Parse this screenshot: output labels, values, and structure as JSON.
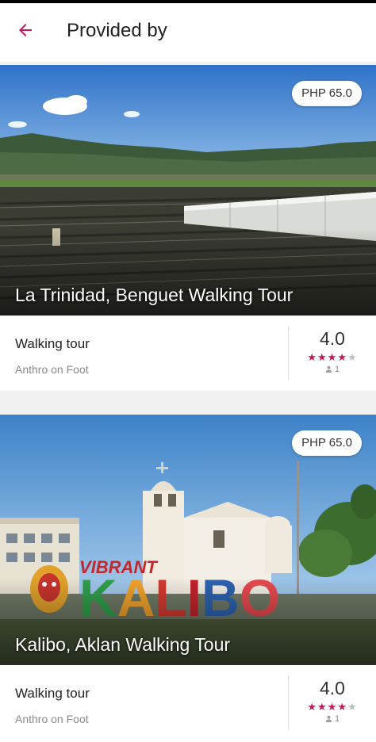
{
  "header": {
    "title": "Provided by"
  },
  "tours": [
    {
      "title": "La Trinidad, Benguet Walking Tour",
      "price": "PHP 65.0",
      "type": "Walking tour",
      "provider": "Anthro on Foot",
      "rating": "4.0",
      "rating_stars": 4,
      "rating_count": "1"
    },
    {
      "title": "Kalibo, Aklan Walking Tour",
      "price": "PHP 65.0",
      "type": "Walking tour",
      "provider": "Anthro on Foot",
      "rating": "4.0",
      "rating_stars": 4,
      "rating_count": "1",
      "sign_letters": "KALIBO",
      "sign_banner": "VIBRANT"
    }
  ],
  "colors": {
    "accent": "#c2185b",
    "background": "#f1f1f1"
  },
  "icons": {
    "back": "arrow-left-icon",
    "star": "star-icon",
    "person": "person-icon"
  }
}
